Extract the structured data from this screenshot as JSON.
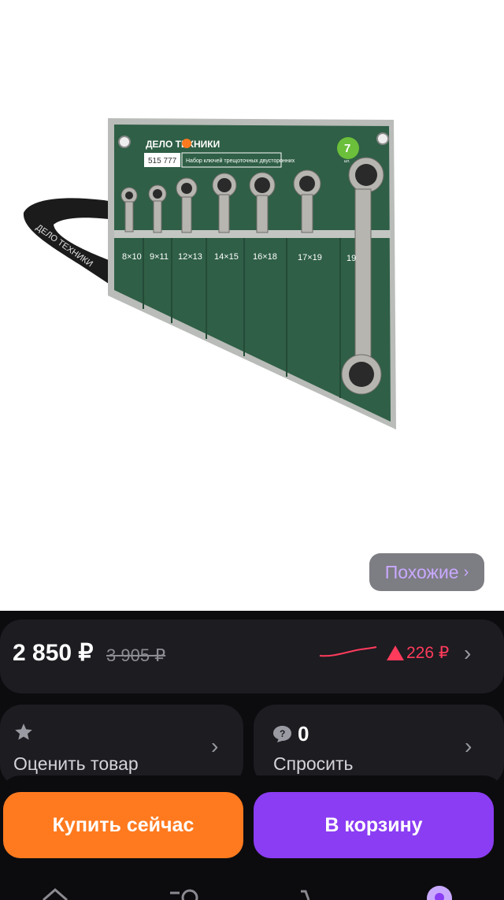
{
  "gallery": {
    "image_label": "wrench-set-product-image",
    "brand_text": "ДЕЛО ТЕХНИКИ",
    "article_no": "515 777",
    "product_caption": "Набор ключей трещоточных двусторонних",
    "count_badge": "7",
    "count_unit": "шт.",
    "sizes": [
      "8×10",
      "9×11",
      "12×13",
      "14×15",
      "16×18",
      "17×19",
      "19"
    ],
    "similar_label": "Похожие",
    "similar_chevron": "›"
  },
  "price": {
    "current": "2 850 ₽",
    "old": "3 905 ₽",
    "delta": "226 ₽",
    "trend_color": "#ff3b5c",
    "chevron": "›"
  },
  "rate": {
    "label": "Оценить товар",
    "icon": "star-icon",
    "chevron": "›"
  },
  "ask": {
    "label": "Спросить",
    "count": "0",
    "icon": "question-bubble-icon",
    "chevron": "›"
  },
  "actions": {
    "buy_now": "Купить сейчас",
    "add_to_cart": "В корзину",
    "buy_color": "#ff7a1f",
    "cart_color": "#8b3df3"
  },
  "tabbar": {
    "icons": [
      "home-icon",
      "search-icon",
      "cart-icon",
      "profile-icon"
    ]
  }
}
